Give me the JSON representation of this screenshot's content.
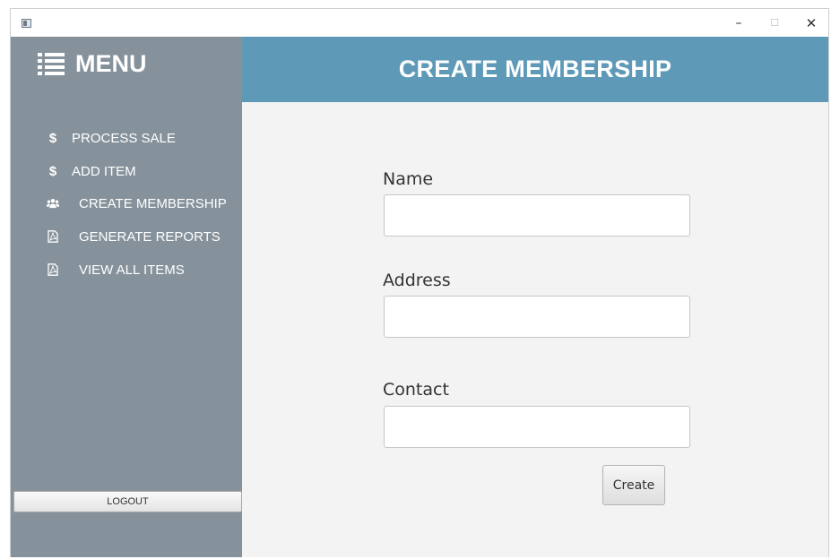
{
  "window": {
    "minimize_glyph": "–",
    "maximize_glyph": "☐",
    "close_glyph": "✕"
  },
  "sidebar": {
    "title": "MENU",
    "title_icon": "list-icon",
    "items": [
      {
        "label": "PROCESS SALE",
        "icon": "dollar-icon",
        "glyph": "$"
      },
      {
        "label": "ADD ITEM",
        "icon": "dollar-icon",
        "glyph": "$"
      },
      {
        "label": "CREATE MEMBERSHIP",
        "icon": "users-icon"
      },
      {
        "label": "GENERATE REPORTS",
        "icon": "pdf-file-icon"
      },
      {
        "label": "VIEW ALL ITEMS",
        "icon": "pdf-file-icon"
      }
    ],
    "logout_label": "LOGOUT"
  },
  "header": {
    "title": "CREATE MEMBERSHIP"
  },
  "form": {
    "name_label": "Name",
    "name_value": "",
    "address_label": "Address",
    "address_value": "",
    "contact_label": "Contact",
    "contact_value": "",
    "create_label": "Create"
  },
  "colors": {
    "sidebar_bg": "#86929b",
    "header_bg": "#5e9ab8",
    "content_bg": "#f3f3f3"
  }
}
